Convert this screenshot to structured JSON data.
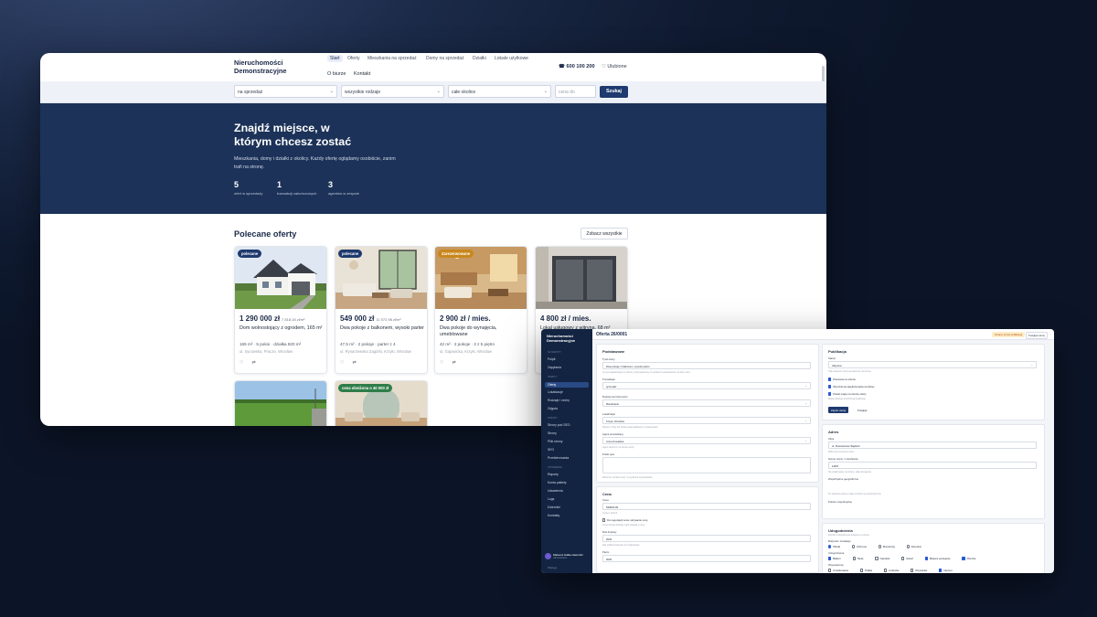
{
  "site": {
    "logo": "Nieruchomości Demonstracyjne",
    "nav": [
      "Start",
      "Oferty",
      "Mieszkania na sprzedaż",
      "Domy na sprzedaż",
      "Działki",
      "Lokale użytkowe",
      "O biurze",
      "Kontakt"
    ],
    "phone": "600 100 200",
    "favorites": "Ulubione",
    "search": {
      "transaction": "na sprzedaż",
      "type": "wszystkie rodzaje",
      "location": "całe okolice",
      "price_placeholder": "cena do",
      "button": "Szukaj"
    },
    "hero": {
      "title": "Znajdź miejsce, w którym chcesz zostać",
      "desc": "Mieszkania, domy i działki z okolicy. Każdy ofertę oglądamy osobiście, zanim trafi na stronę.",
      "stats": [
        {
          "num": "5",
          "label": "ofert w sprzedaży"
        },
        {
          "num": "1",
          "label": "transakcji zakończonych"
        },
        {
          "num": "3",
          "label": "agentów w zespole"
        }
      ]
    },
    "featured": {
      "title": "Polecane oferty",
      "see_all": "Zobacz wszystkie",
      "cards": [
        {
          "badge": "polecane",
          "price": "1 290 000 zł",
          "ppm": "7 818,18 zł/m²",
          "title": "Dom wolnostojący z ogrodem, 165 m²",
          "meta": "165 m² · 5 pokoi · działka 820 m²",
          "loc": "ul. Sycowska, Pracze, Wrocław"
        },
        {
          "badge": "polecane",
          "price": "549 000 zł",
          "ppm": "11 572,98 zł/m²",
          "title": "Dwa pokoje z balkonem, wysoki parter",
          "meta": "47,5 m² · 2 pokoje · parter z 4",
          "loc": "ul. Rynarzewska Zagórki, Krzyki, Wrocław"
        },
        {
          "badge": "Zarezerwowane",
          "price": "2 900 zł / mies.",
          "ppm": "",
          "title": "Dwa pokoje do wynajęcia, umeblowane",
          "meta": "42 m² · 2 pokoje · 3 z 5 piętro",
          "loc": "ul. Gajowicka, Krzyki, Wrocław"
        },
        {
          "badge": "",
          "price": "4 800 zł / mies.",
          "ppm": "",
          "title": "Lokal usługowy z witryną, 68 m²",
          "meta": "",
          "loc": ""
        }
      ],
      "row2": [
        {
          "badge": ""
        },
        {
          "badge": "cena obniżona o 40 000 zł"
        }
      ]
    }
  },
  "admin": {
    "logo": "Nieruchomości Demonstracyjne",
    "title": "Oferta 26/0001",
    "status": "Zmiany przed publikacją",
    "view_link": "Podgląd oferty",
    "sidebar": {
      "sections": [
        "Na skróty",
        "Oferty",
        "Strony",
        "Ustawienia"
      ],
      "items": [
        "Pulpit",
        "Zapytania",
        "Oferty",
        "Lokalizacje",
        "Rodzaje i cechy",
        "Zdjęcia",
        "Strony pod SEO",
        "Strony",
        "Pliki strony",
        "SEO",
        "Przekierowania",
        "Raporty",
        "Konta pakiety",
        "Ustawienia",
        "Logs",
        "Dzienniki",
        "Kontakty"
      ],
      "user_name": "Mateusz Halka-Jaworski",
      "user_role": "Administrator",
      "logout": "Wyloguj"
    },
    "basics": {
      "head": "Podstawowe",
      "title_label": "Tytuł oferty",
      "title_value": "Dwa pokoje z balkonem, wysoki parter",
      "title_hint": "Co jest najważniejsze w ofercie, tytuł pojawia się w wynikach wyszukiwania i na liście ofert.",
      "transaction_label": "Transakcja",
      "transaction_value": "sprzedaż",
      "type_label": "Rodzaj nieruchomości",
      "type_value": "Mieszkanie",
      "location_label": "Lokalizacja",
      "location_value": "Krzyki, Wrocław",
      "location_hint": "Wybierz z listy lub dodaj nową lokalizację w ustawieniach.",
      "agent_label": "Agent prowadzący",
      "agent_value": "Anna Kowalska",
      "agent_hint": "Agent widoczny na stronie oferty.",
      "desc_label": "Krótki opis",
      "desc_hint": "Widoczny na liście ofert i w wynikach wyszukiwania."
    },
    "pricing": {
      "head": "Cena",
      "price_label": "Cena",
      "price_value": "549000,00",
      "currency_hint": "Cena w złotych",
      "negotiable": "Do negocjacji cena; ukrywanie ceny",
      "negotiable_hint": "Cena ukryta pokazuje napis Zapytaj o cenę.",
      "year_label": "Rok budowy",
      "year_value": "2020",
      "year_hint": "Rok oddania budynku do użytkowania",
      "floor_label": "Piętro",
      "floor_value": "2020"
    },
    "publish": {
      "head": "Publikacja",
      "status_label": "Status",
      "status_value": "Aktywna",
      "status_hint": "Tylko aktywne oferty są widoczne na stronie.",
      "featured": "Polecana na stronie",
      "highlighted": "Wyróżniona (większa karta na liście)",
      "show_map": "Pokaż mapę na stronie oferty",
      "map_hint": "Mapa pokazuje przybliżoną lokalizację.",
      "save": "Zapisz ofertę",
      "preview": "Podgląd"
    },
    "address": {
      "head": "Adres",
      "street_label": "Ulica",
      "street_value": "ul. Powstańców Śląskich",
      "street_hint": "Widoczna na stronie oferty",
      "number_label": "Numer domu / mieszkania",
      "number_value": "148/3",
      "number_hint": "Nie pokazywany na stronie, tylko dla agenta.",
      "geo_label": "Współrzędne geograficzne",
      "geo_hint": "Po zapisaniu adresu mapa uzupełni się automatycznie.",
      "geo_link": "Pobierz współrzędne"
    },
    "amenities": {
      "head": "Udogodnienia",
      "hint": "Zaznacz udogodnienia dostępne w ofercie.",
      "building_label": "Budynek i instalacje",
      "building_opts": [
        "Winda",
        "Ochrona",
        "Monitoring",
        "Domofon"
      ],
      "outdoor_label": "Udogodnienia",
      "outdoor_opts": [
        "Balkon",
        "Taras",
        "Ogródek",
        "Garaż",
        "Miejsce postojowe",
        "Piwnica"
      ],
      "finish_label": "Wyposażenie",
      "finish_opts": [
        "Umeblowanie",
        "Pralka",
        "Lodówka",
        "Zmywarka",
        "Internet"
      ]
    }
  }
}
